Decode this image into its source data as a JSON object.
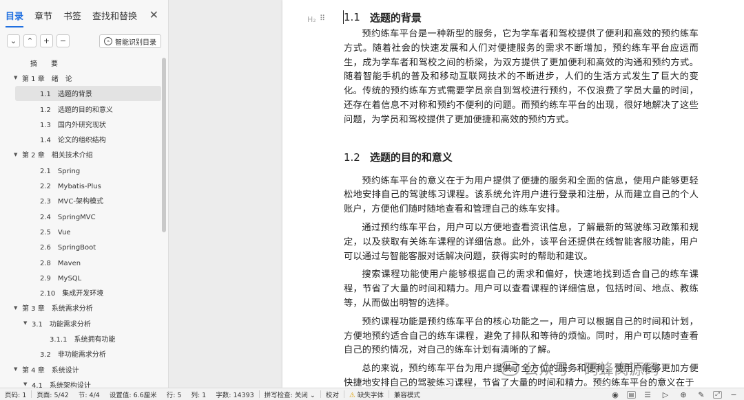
{
  "sidebar": {
    "tabs": [
      "目录",
      "章节",
      "书签",
      "查找和替换"
    ],
    "close": "✕",
    "toolbar": {
      "collapse": "⌄",
      "expand": "⌃",
      "add": "+",
      "remove": "−",
      "smart_label": "智能识别目录"
    },
    "toc": [
      {
        "text": "摘　　要",
        "level": "lvl0",
        "arrow": ""
      },
      {
        "text": "第 1 章　绪　论",
        "level": "lvl1",
        "arrow": "▼"
      },
      {
        "text": "1.1　选题的背景",
        "level": "lvl2",
        "arrow": "",
        "selected": true
      },
      {
        "text": "1.2　选题的目的和意义",
        "level": "lvl2",
        "arrow": ""
      },
      {
        "text": "1.3　国内外研究现状",
        "level": "lvl2",
        "arrow": ""
      },
      {
        "text": "1.4　论文的组织结构",
        "level": "lvl2",
        "arrow": ""
      },
      {
        "text": "第 2 章　相关技术介绍",
        "level": "lvl1",
        "arrow": "▼"
      },
      {
        "text": "2.1　Spring",
        "level": "lvl2",
        "arrow": ""
      },
      {
        "text": "2.2　Mybatis-Plus",
        "level": "lvl2",
        "arrow": ""
      },
      {
        "text": "2.3　MVC-架构模式",
        "level": "lvl2",
        "arrow": ""
      },
      {
        "text": "2.4　SpringMVC",
        "level": "lvl2",
        "arrow": ""
      },
      {
        "text": "2.5　Vue",
        "level": "lvl2",
        "arrow": ""
      },
      {
        "text": "2.6　SpringBoot",
        "level": "lvl2",
        "arrow": ""
      },
      {
        "text": "2.8　Maven",
        "level": "lvl2",
        "arrow": ""
      },
      {
        "text": "2.9　MySQL",
        "level": "lvl2",
        "arrow": ""
      },
      {
        "text": "2.10　集成开发环境",
        "level": "lvl2",
        "arrow": ""
      },
      {
        "text": "第 3 章　系统需求分析",
        "level": "lvl1",
        "arrow": "▼"
      },
      {
        "text": "3.1　功能需求分析",
        "level": "lvl2b",
        "arrow": "▼"
      },
      {
        "text": "3.1.1　系统拥有功能",
        "level": "lvl3",
        "arrow": ""
      },
      {
        "text": "3.2　非功能需求分析",
        "level": "lvl2",
        "arrow": ""
      },
      {
        "text": "第 4 章　系统设计",
        "level": "lvl1",
        "arrow": "▼"
      },
      {
        "text": "4.1　系统架构设计",
        "level": "lvl2b",
        "arrow": "▼"
      }
    ]
  },
  "document": {
    "heading_mark": "H₂",
    "drag_handle": "⠿",
    "sections": [
      {
        "number": "1.1",
        "title": "选题的背景",
        "paragraphs": [
          "预约练车平台是一种新型的服务，它为学车者和驾校提供了便利和高效的预约练车方式。随着社会的快速发展和人们对便捷服务的需求不断增加，预约练车平台应运而生，成为学车者和驾校之间的桥梁，为双方提供了更加便利和高效的沟通和预约方式。随着智能手机的普及和移动互联网技术的不断进步，人们的生活方式发生了巨大的变化。传统的预约练车方式需要学员亲自到驾校进行预约，不仅浪费了学员大量的时间，还存在着信息不对称和预约不便利的问题。而预约练车平台的出现，很好地解决了这些问题，为学员和驾校提供了更加便捷和高效的预约方式。"
        ]
      },
      {
        "number": "1.2",
        "title": "选题的目的和意义",
        "paragraphs": [
          "预约练车平台的意义在于为用户提供了便捷的服务和全面的信息，使用户能够更轻松地安排自己的驾驶练习课程。该系统允许用户进行登录和注册，从而建立自己的个人账户，方便他们随时随地查看和管理自己的练车安排。",
          "通过预约练车平台，用户可以方便地查看资讯信息，了解最新的驾驶练习政策和规定，以及获取有关练车课程的详细信息。此外，该平台还提供在线智能客服功能，用户可以通过与智能客服对话解决问题，获得实时的帮助和建议。",
          "搜索课程功能使用户能够根据自己的需求和偏好，快速地找到适合自己的练车课程，节省了大量的时间和精力。用户可以查看课程的详细信息，包括时间、地点、教练等，从而做出明智的选择。",
          "预约课程功能是预约练车平台的核心功能之一，用户可以根据自己的时间和计划，方便地预约适合自己的练车课程，避免了排队和等待的烦恼。同时，用户可以随时查看自己的预约情况，对自己的练车计划有清晰的了解。",
          "总的来说，预约练车平台为用户提供了全方位的服务和便利，使用户能够更加方便快捷地安排自己的驾驶练习课程，节省了大量的时间和精力。预约练车平台的意义在于"
        ]
      }
    ],
    "watermark": "公众号 · 码蜂窝源码",
    "watermark_icon": "●●"
  },
  "statusbar": {
    "items": [
      "页码: 1",
      "页面: 5/42",
      "节: 4/4",
      "设置值: 6.6厘米",
      "行: 5",
      "列: 1",
      "字数: 14393",
      "拼写检查: 关闭 ⌄",
      "校对",
      "缺失字体",
      "兼容模式"
    ],
    "warn_icon": "⚠",
    "right_icons": [
      "◉",
      "▤",
      "☰",
      "▷",
      "⊕",
      "✎",
      "⤢",
      "−"
    ]
  }
}
